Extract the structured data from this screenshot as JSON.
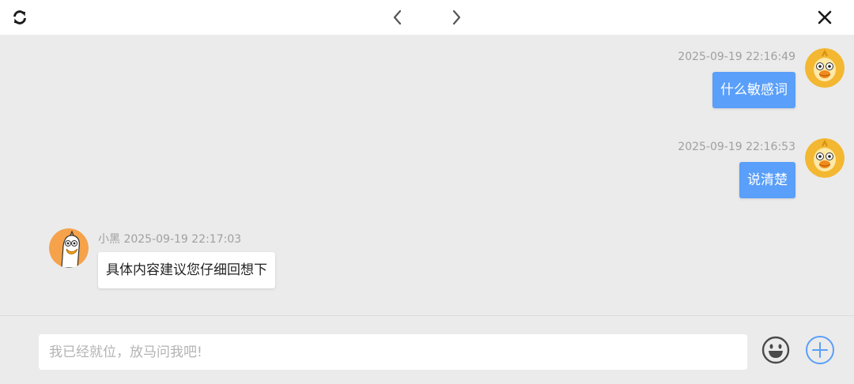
{
  "toolbar": {
    "refresh_icon": "refresh-icon",
    "back_icon": "chevron-left-icon",
    "forward_icon": "chevron-right-icon",
    "close_icon": "close-icon"
  },
  "messages": [
    {
      "direction": "outgoing",
      "timestamp": "2025-09-19 22:16:49",
      "text": "什么敏感词"
    },
    {
      "direction": "outgoing",
      "timestamp": "2025-09-19 22:16:53",
      "text": "说清楚"
    },
    {
      "direction": "incoming",
      "timestamp": "小黑 2025-09-19 22:17:03",
      "text": "具体内容建议您仔细回想下"
    }
  ],
  "composer": {
    "placeholder": "我已经就位，放马问我吧!",
    "value": "",
    "emoji_icon": "emoji-icon",
    "add_icon": "plus-circle-icon"
  },
  "colors": {
    "outgoing_bubble": "#5a9ff9",
    "incoming_bubble": "#ffffff",
    "background": "#ebebeb",
    "accent": "#5a9ff9"
  }
}
